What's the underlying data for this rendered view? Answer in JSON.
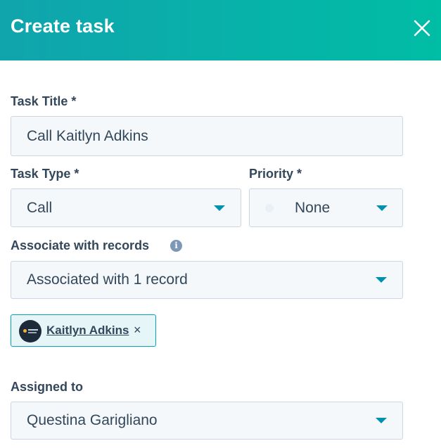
{
  "header": {
    "title": "Create task"
  },
  "icons": {
    "close": "close-icon",
    "info": "info-icon",
    "caret": "caret-down-icon",
    "remove": "remove-icon"
  },
  "colors": {
    "header_start": "#10a4ad",
    "header_end": "#00bda5",
    "accent": "#0091ae",
    "chip_border": "#00a4bd"
  },
  "task_title": {
    "label": "Task Title *",
    "value": "Call Kaitlyn Adkins"
  },
  "task_type": {
    "label": "Task Type *",
    "value": "Call"
  },
  "priority": {
    "label": "Priority *",
    "value": "None"
  },
  "associate": {
    "label": "Associate with records",
    "value": "Associated with 1 record",
    "records": [
      {
        "name": "Kaitlyn Adkins",
        "remove": "×"
      }
    ]
  },
  "assigned": {
    "label": "Assigned to",
    "value": "Questina Garigliano"
  }
}
